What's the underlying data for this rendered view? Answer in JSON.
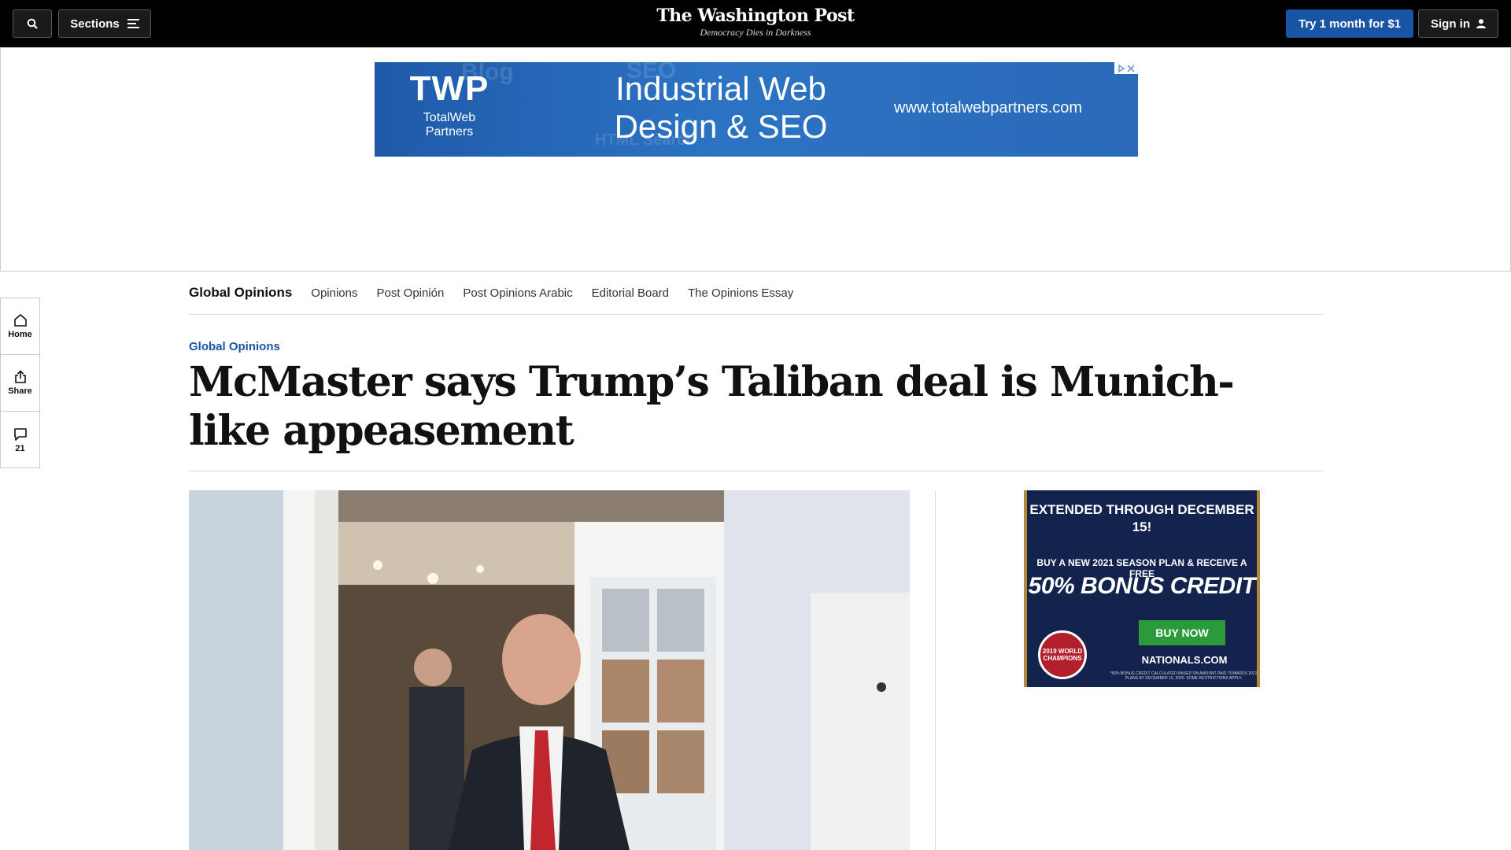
{
  "topbar": {
    "sections_label": "Sections",
    "logo": "The Washington Post",
    "tagline": "Democracy Dies in Darkness",
    "subscribe_label": "Try 1 month for $1",
    "signin_label": "Sign in",
    "icons": {
      "search": "search-icon",
      "menu": "hamburger-icon",
      "user": "user-icon"
    }
  },
  "top_ad": {
    "logo_mark": "TWP",
    "logo_text": "TotalWeb Partners",
    "headline": "Industrial Web Design & SEO",
    "url": "www.totalwebpartners.com"
  },
  "subnav": {
    "brand": "Global Opinions",
    "items": [
      "Opinions",
      "Post Opinión",
      "Post Opinions Arabic",
      "Editorial Board",
      "The Opinions Essay"
    ]
  },
  "rail": {
    "home_label": "Home",
    "share_label": "Share",
    "comments_count": "21"
  },
  "article": {
    "kicker": "Global Opinions",
    "headline": "McMaster says Trump’s Taliban deal is Munich-like appeasement"
  },
  "side_ad": {
    "line1": "EXTENDED THROUGH DECEMBER 15!",
    "line2": "BUY A NEW 2021 SEASON PLAN & RECEIVE A FREE",
    "line3": "50% BONUS CREDIT",
    "button": "BUY NOW",
    "site": "NATIONALS.COM",
    "badge": "2019 WORLD CHAMPIONS",
    "fine_print": "*50% BONUS CREDIT CALCULATED BASED ON AMOUNT PAID TOWARDS 2021 PLANS BY DECEMBER 15, 2020. SOME RESTRICTIONS APPLY."
  },
  "colors": {
    "topbar_bg": "#000000",
    "accent_blue": "#1955a5",
    "kicker_blue": "#1955a5",
    "ad_blue": "#2a6ab8",
    "nationals_navy": "#13234d",
    "buy_green": "#2a9a3a"
  }
}
